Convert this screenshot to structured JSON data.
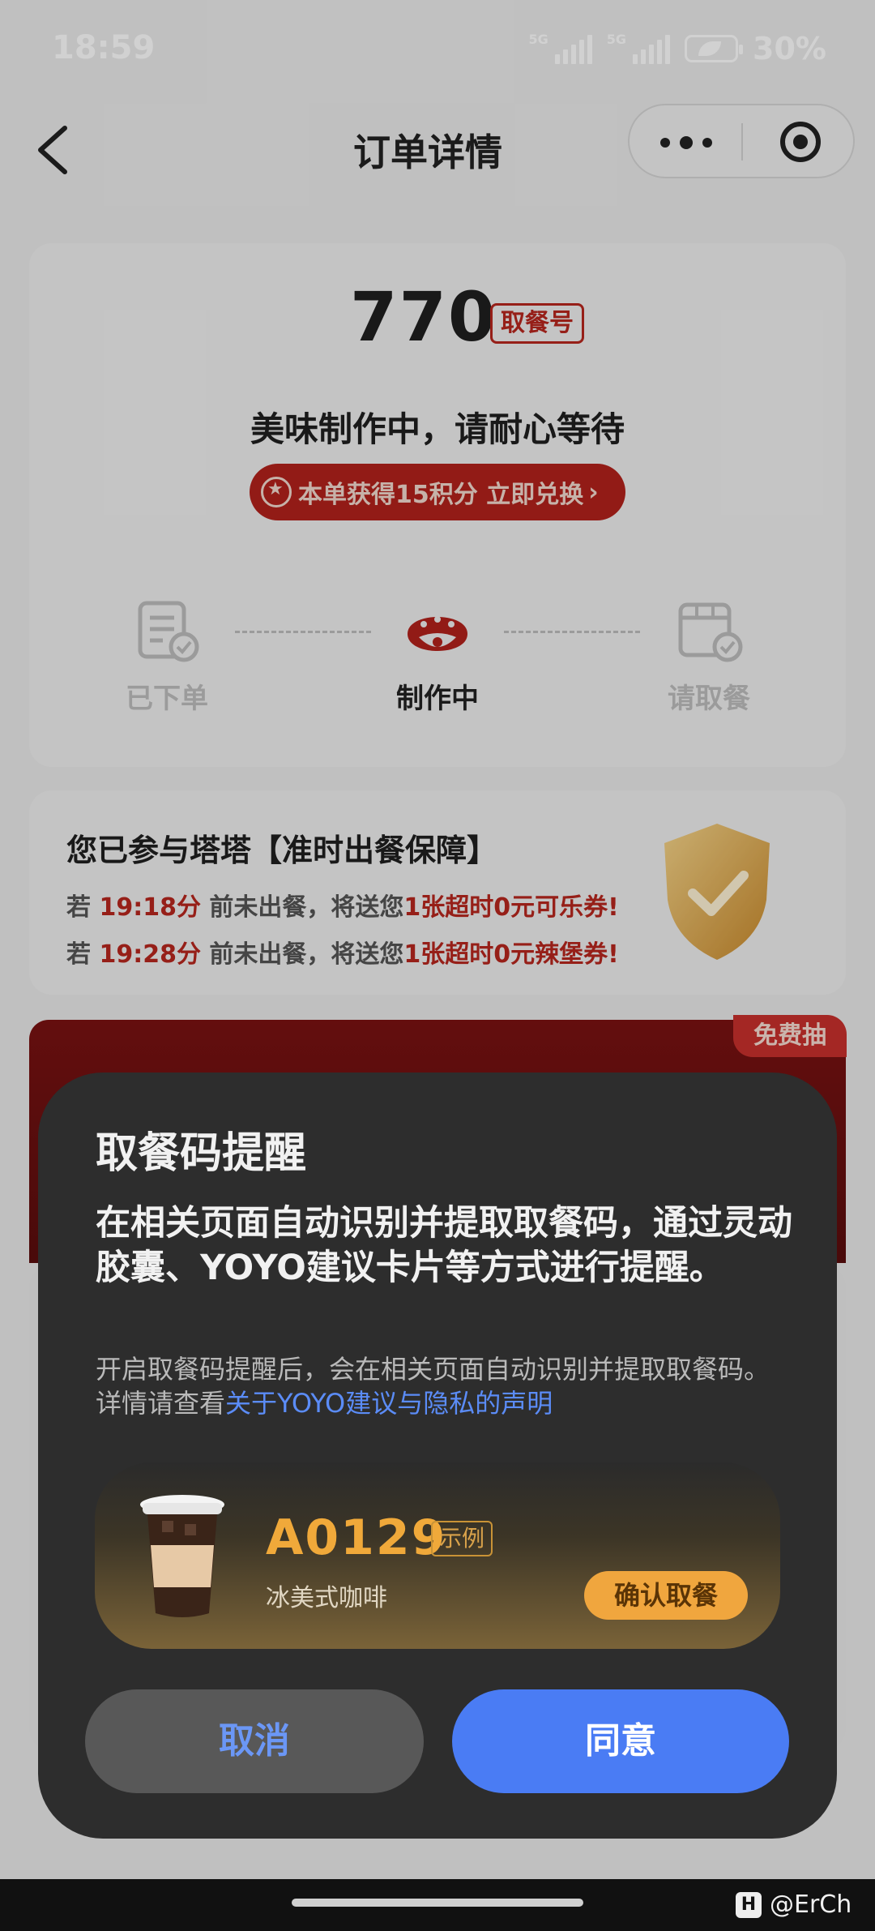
{
  "status_bar": {
    "time": "18:59",
    "signal1_tag": "5G",
    "signal2_tag": "5G",
    "battery": "30%"
  },
  "nav": {
    "title": "订单详情"
  },
  "order": {
    "pickup_number": "770",
    "pickup_tag": "取餐号",
    "status_message": "美味制作中，请耐心等待",
    "points_text": "本单获得15积分 立即兑换"
  },
  "steps": [
    {
      "label": "已下单"
    },
    {
      "label": "制作中"
    },
    {
      "label": "请取餐"
    }
  ],
  "guarantee": {
    "title": "您已参与塔塔【准时出餐保障】",
    "lines": [
      {
        "prefix": "若 ",
        "time": "19:18分",
        "middle": " 前未出餐，将送您",
        "reward": "1张超时0元可乐券!"
      },
      {
        "prefix": "若 ",
        "time": "19:28分",
        "middle": " 前未出餐，将送您",
        "reward": "1张超时0元辣堡券!"
      }
    ]
  },
  "banner": {
    "tag": "免费抽"
  },
  "dialog": {
    "title": "取餐码提醒",
    "main_text": "在相关页面自动识别并提取取餐码，通过灵动胶囊、YOYO建议卡片等方式进行提醒。",
    "sub_text": "开启取餐码提醒后，会在相关页面自动识别并提取取餐码。详情请查看",
    "sub_link": "关于YOYO建议与隐私的声明",
    "example": {
      "code": "A0129",
      "tag": "示例",
      "item": "冰美式咖啡",
      "button": "确认取餐"
    },
    "cancel_label": "取消",
    "agree_label": "同意"
  },
  "watermark": {
    "text": "@ErCh"
  },
  "colors": {
    "brand_red": "#b3221c",
    "accent_blue": "#4a7cf4",
    "accent_orange": "#f0a63e"
  }
}
